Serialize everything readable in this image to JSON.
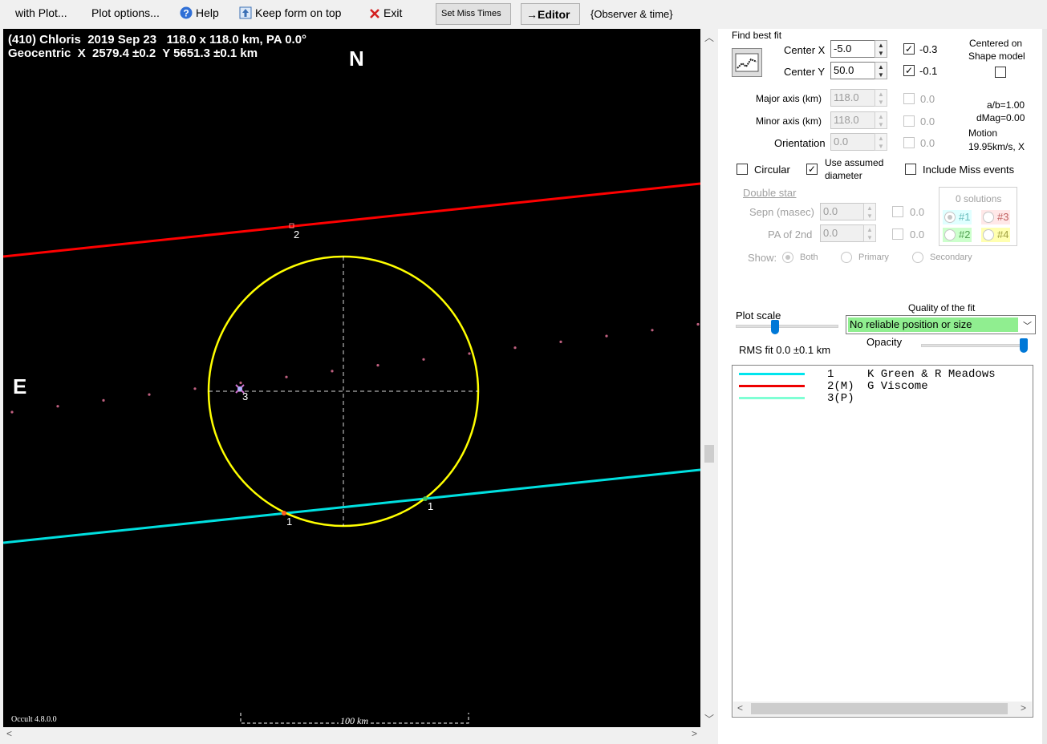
{
  "toolbar": {
    "with_plot": "with Plot...",
    "plot_options": "Plot options...",
    "help": "Help",
    "keep_on_top": "Keep form on top",
    "exit": "Exit",
    "set_miss_times": "Set Miss Times",
    "editor": "→Editor",
    "observer_time": "{Observer & time}"
  },
  "plot": {
    "title_line1": "(410) Chloris  2019 Sep 23   118.0 x 118.0 km, PA 0.0°",
    "title_line2": "Geocentric  X  2579.4 ±0.2  Y 5651.3 ±0.1 km",
    "north": "N",
    "east": "E",
    "version": "Occult 4.8.0.0",
    "scale_label": "100 km",
    "chord_labels": [
      "2",
      "3",
      "1",
      "1"
    ],
    "colors": {
      "background": "#000000",
      "ellipse": "#ffff00",
      "chord_red": "#ff0000",
      "chord_cyan": "#00e0e0",
      "path_dots": "#c06080"
    }
  },
  "panel": {
    "find_best_fit": "Find best fit",
    "center_x_label": "Center X",
    "center_x_value": "-5.0",
    "center_x_step": "-0.3",
    "center_y_label": "Center Y",
    "center_y_value": "50.0",
    "center_y_step": "-0.1",
    "centered_on": "Centered on",
    "shape_model": "Shape model",
    "major_label": "Major axis (km)",
    "major_value": "118.0",
    "major_step": "0.0",
    "minor_label": "Minor axis (km)",
    "minor_value": "118.0",
    "minor_step": "0.0",
    "orient_label": "Orientation",
    "orient_value": "0.0",
    "orient_step": "0.0",
    "ab_ratio": "a/b=1.00",
    "dmag": "dMag=0.00",
    "motion_label": "Motion",
    "motion_value": "19.95km/s, X",
    "circular": "Circular",
    "use_assumed_1": "Use assumed",
    "use_assumed_2": "diameter",
    "include_miss": "Include Miss events",
    "double_star": "Double star",
    "sepn_label": "Sepn (masec)",
    "sepn_value": "0.0",
    "sepn_step": "0.0",
    "pa2_label": "PA of 2nd",
    "pa2_value": "0.0",
    "pa2_step": "0.0",
    "show_label": "Show:",
    "show_both": "Both",
    "show_primary": "Primary",
    "show_secondary": "Secondary",
    "solutions": "0 solutions",
    "sol1": "#1",
    "sol2": "#2",
    "sol3": "#3",
    "sol4": "#4",
    "plot_scale": "Plot scale",
    "quality_label": "Quality of the fit",
    "quality_value": "No reliable position or size",
    "opacity": "Opacity",
    "rms_fit": "RMS fit 0.0 ±0.1 km"
  },
  "legend": [
    {
      "num": "1",
      "name": "K Green & R Meadows",
      "color": "#00e5ee"
    },
    {
      "num": "2(M)",
      "name": "G Viscome",
      "color": "#ee0000"
    },
    {
      "num": "3(P)",
      "name": "",
      "color": "#7fffd4"
    }
  ]
}
